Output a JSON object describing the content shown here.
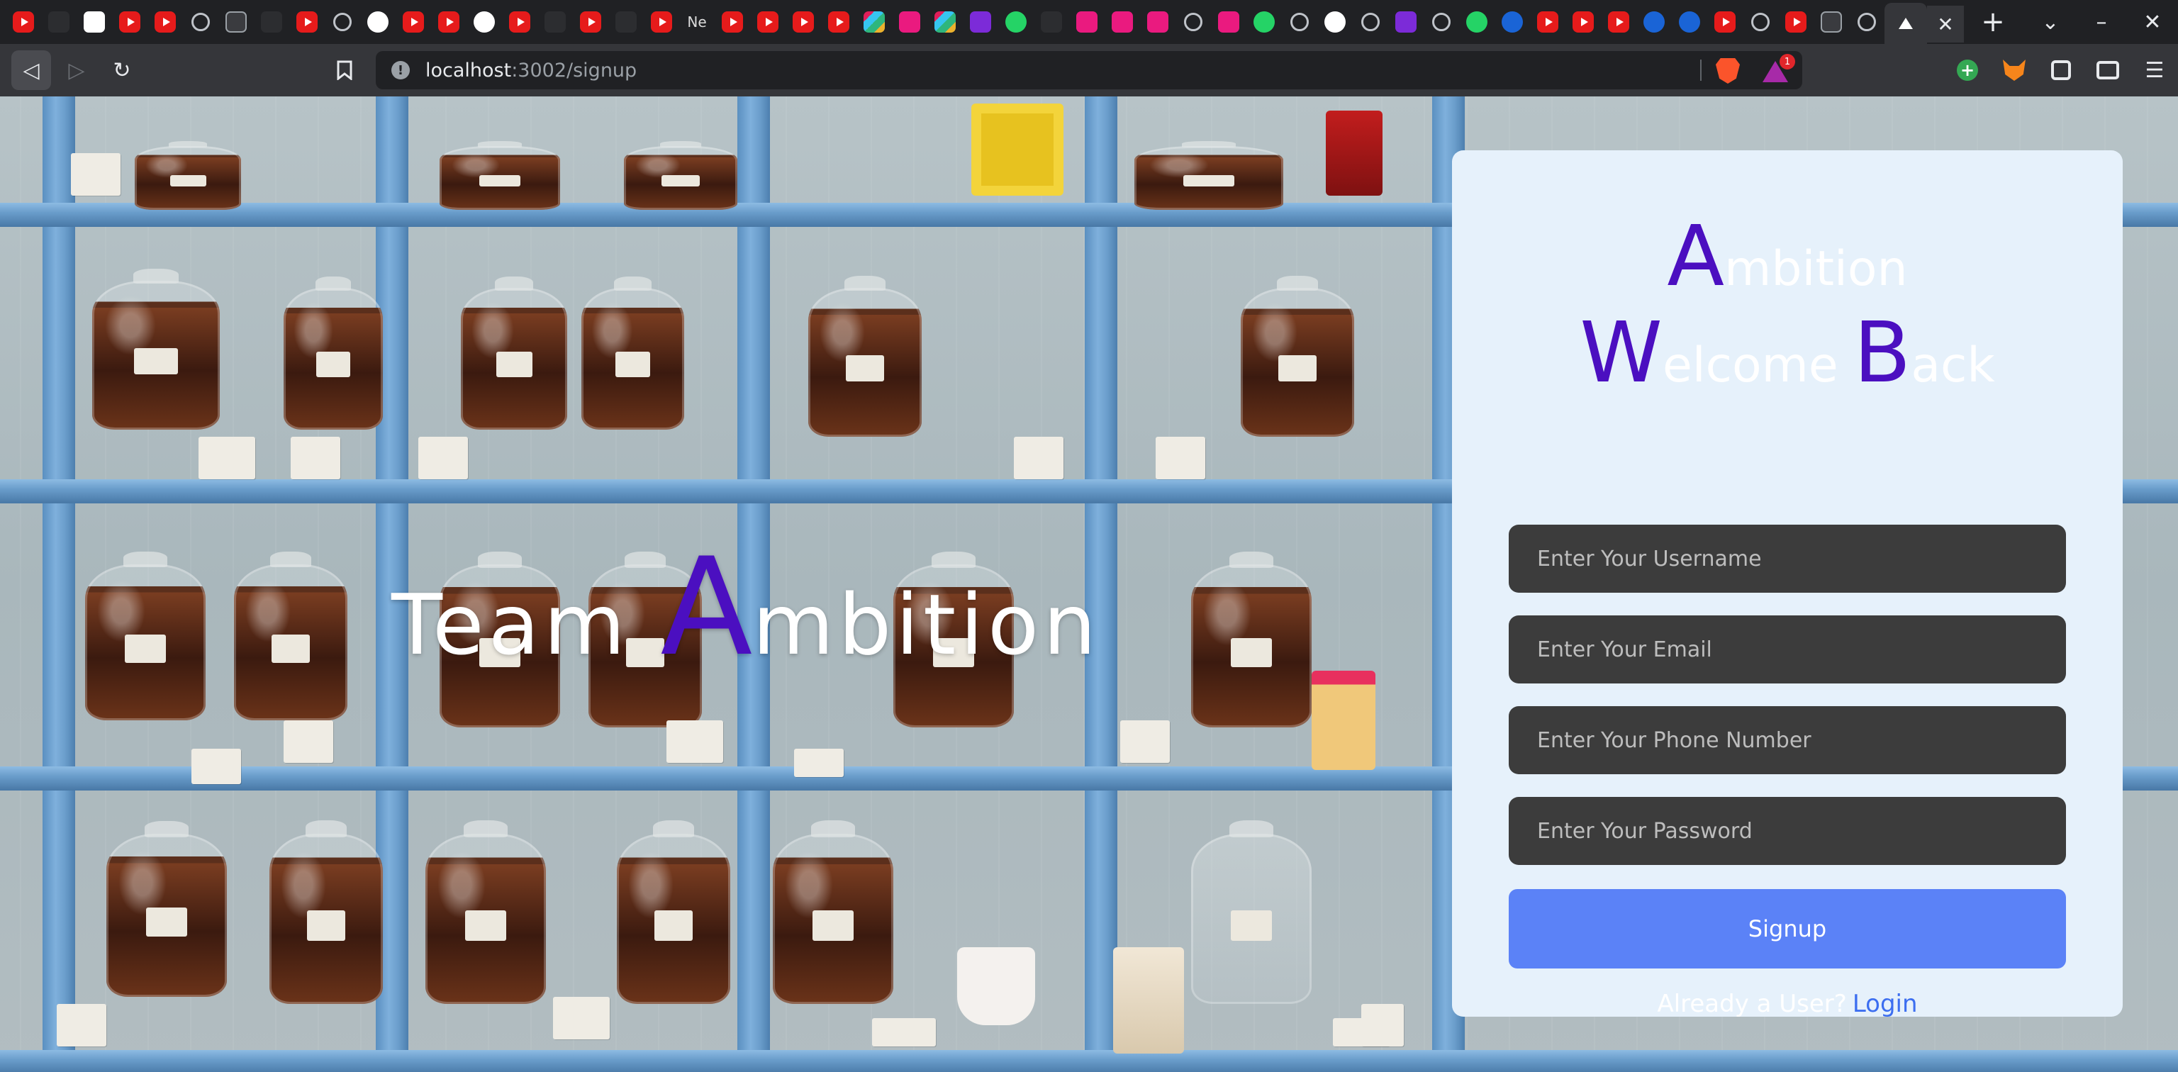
{
  "browser": {
    "tabs": [
      "youtube",
      "django",
      "notes",
      "youtube",
      "youtube",
      "globe",
      "image",
      "medium",
      "youtube",
      "info",
      "github",
      "youtube",
      "youtube",
      "github",
      "youtube",
      "bot",
      "youtube",
      "github-dark",
      "youtube",
      "text-ne",
      "youtube",
      "youtube",
      "youtube",
      "youtube",
      "slack",
      "chat",
      "slack",
      "list",
      "leaf",
      "bars",
      "chat",
      "chat",
      "chat",
      "globe",
      "unicorn",
      "leaf-green",
      "globe",
      "github",
      "globe",
      "vite",
      "globe",
      "whatsapp",
      "flutter",
      "youtube",
      "youtube",
      "youtube",
      "chart",
      "c-logo",
      "youtube",
      "globe",
      "youtube",
      "image",
      "globe",
      "active"
    ],
    "tab_text_ne": "Ne",
    "active_tab_icon": "triangle-icon",
    "close_tab": "✕",
    "new_tab": "+",
    "window_controls": [
      "⌄",
      "–",
      "✕"
    ],
    "nav": {
      "back": "◁",
      "forward": "▷",
      "reload": "↻",
      "bookmark": "🔖"
    },
    "url_host": "localhost",
    "url_rest": ":3002/signup",
    "rewards_badge": "1",
    "menu": "☰"
  },
  "page": {
    "hero": {
      "prefix": "Team ",
      "cap": "A",
      "rest": "mbition"
    },
    "card": {
      "line1": {
        "cap": "A",
        "rest": "mbition"
      },
      "line2": {
        "cap1": "W",
        "rest1": "elcome ",
        "cap2": "B",
        "rest2": "ack"
      },
      "fields": {
        "username": "Enter Your Username",
        "email": "Enter Your Email",
        "phone": "Enter Your Phone Number",
        "password": "Enter Your Password"
      },
      "signup_label": "Signup",
      "already_text": "Already a User?",
      "login_label": "Login"
    }
  },
  "colors": {
    "accent_purple": "#4b0fc0",
    "button_blue": "#5b82f7",
    "link_blue": "#3c6ef0",
    "card_bg": "#e6f1fb",
    "field_bg": "#3c3c3c"
  }
}
